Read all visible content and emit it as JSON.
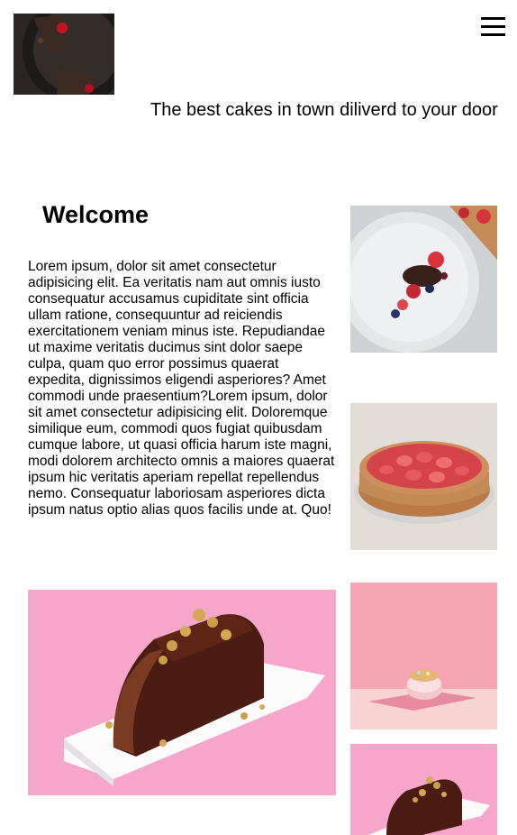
{
  "header": {
    "logo_icon": "chocolate-cake-plate-logo",
    "menu_icon": "hamburger-menu-icon",
    "tagline": "The best cakes in town diliverd to your door"
  },
  "main": {
    "heading": "Welcome",
    "paragraph": "Lorem ipsum, dolor sit amet consectetur adipisicing elit. Ea veritatis nam aut omnis iusto consequatur accusamus cupiditate sint officia ullam ratione, consequuntur ad reiciendis exercitationem veniam minus iste. Repudiandae ut maxime veritatis ducimus sint dolor saepe culpa, quam quo error possimus quaerat expedita, dignissimos eligendi asperiores? Amet commodi unde praesentium?Lorem ipsum, dolor sit amet consectetur adipisicing elit. Doloremque similique eum, commodi quos fugiat quibusdam cumque labore, ut quasi officia harum iste magni, modi dolorem architecto omnis a maiores quaerat ipsum hic veritatis aperiam repellat repellendus nemo. Consequatur laboriosam asperiores dicta ipsum natus optio alias quos facilis unde at. Quo!"
  },
  "gallery": {
    "images": [
      "berry-plate-image",
      "strawberry-tart-image",
      "chocolate-cake-slice-image",
      "pink-donut-image",
      "chocolate-cake-slice-image-small"
    ]
  },
  "colors": {
    "pink_background": "#f7a8cf",
    "chocolate": "#4a1c12",
    "strawberry": "#d83a3a",
    "dark_plate": "#2a2422"
  }
}
